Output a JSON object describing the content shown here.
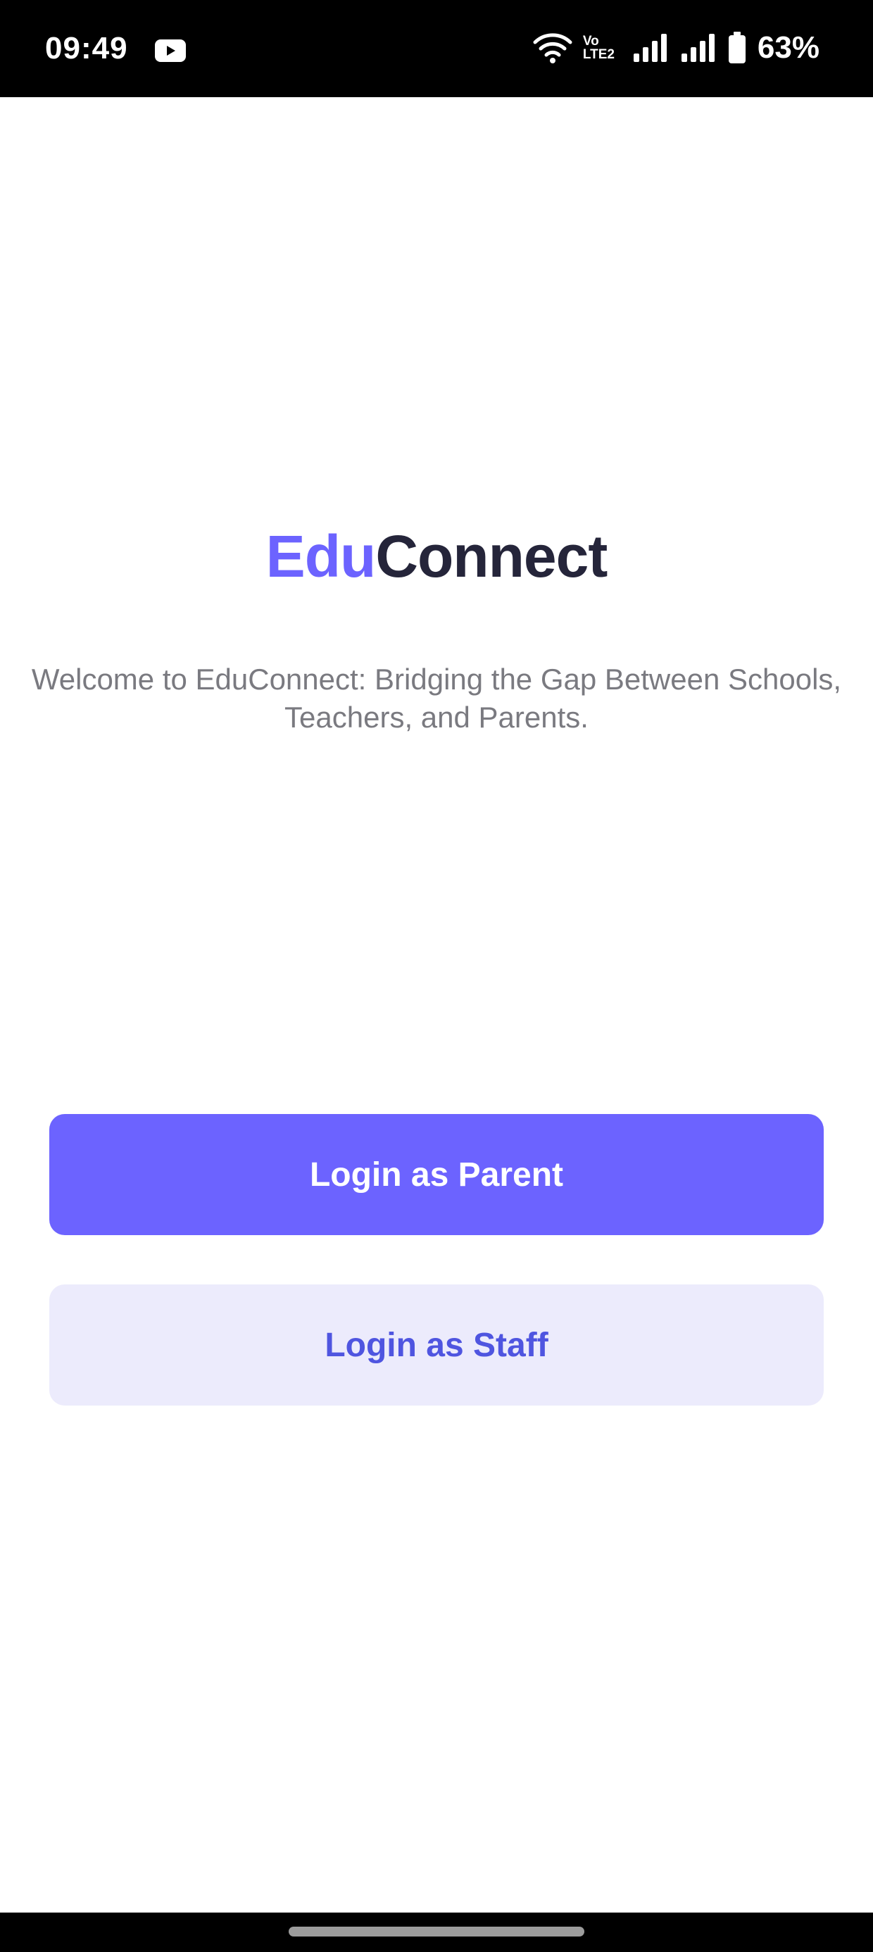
{
  "status_bar": {
    "time": "09:49",
    "network_top": "Vo",
    "network_bottom": "LTE2",
    "battery": "63%",
    "icons": [
      "youtube-icon",
      "wifi-icon",
      "volte-icon",
      "signal-icon",
      "signal-icon",
      "battery-icon"
    ]
  },
  "brand": {
    "part1": "Edu",
    "part2": "Connect",
    "colors": {
      "part1": "#6c63ff",
      "part2": "#25253a"
    }
  },
  "welcome": {
    "line1": "Welcome to EduConnect: Bridging the Gap Between Schools,",
    "line2": "Teachers, and Parents."
  },
  "buttons": {
    "parent_label": "Login as Parent",
    "staff_label": "Login as Staff"
  },
  "colors": {
    "primary": "#6c63ff",
    "secondary_bg": "#ecebfc",
    "secondary_text": "#4f55e0",
    "welcome_text": "#7a7a80"
  }
}
